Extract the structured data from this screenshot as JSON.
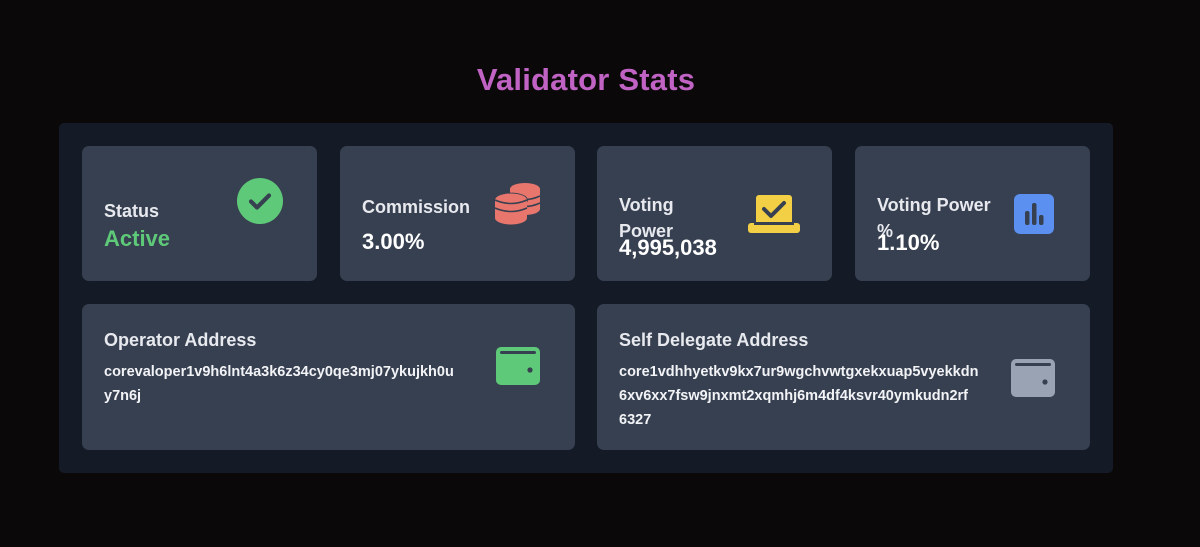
{
  "page": {
    "title": "Validator Stats"
  },
  "stats": {
    "status": {
      "label": "Status",
      "value": "Active",
      "icon": "check-circle-icon",
      "icon_color": "#5ec978"
    },
    "commission": {
      "label": "Commission",
      "value": "3.00%",
      "icon": "coins-icon",
      "icon_color": "#e8766d"
    },
    "voting_power": {
      "label_line1": "Voting",
      "label_line2": "Power",
      "value": "4,995,038",
      "icon": "vote-box-icon",
      "icon_color": "#f2cf44"
    },
    "voting_power_pct": {
      "label_line1": "Voting Power",
      "label_line2": "%",
      "value": "1.10%",
      "icon": "bar-chart-icon",
      "icon_color": "#5b8ff0"
    }
  },
  "addresses": {
    "operator": {
      "label": "Operator Address",
      "line1": "corevaloper1v9h6lnt4a3k6z34cy0qe3mj07ykujkh0u",
      "line2": "y7n6j",
      "icon": "wallet-icon",
      "icon_color": "#5ec978"
    },
    "self_delegate": {
      "label": "Self Delegate Address",
      "line1": "core1vdhhyetkv9kx7ur9wgchvwtgxekxuap5vyekkdn",
      "line2": "6xv6xx7fsw9jnxmt2xqmhj6m4df4ksvr40ymkudn2rf",
      "line3": "6327",
      "icon": "wallet-icon",
      "icon_color": "#9aa3b4"
    }
  }
}
